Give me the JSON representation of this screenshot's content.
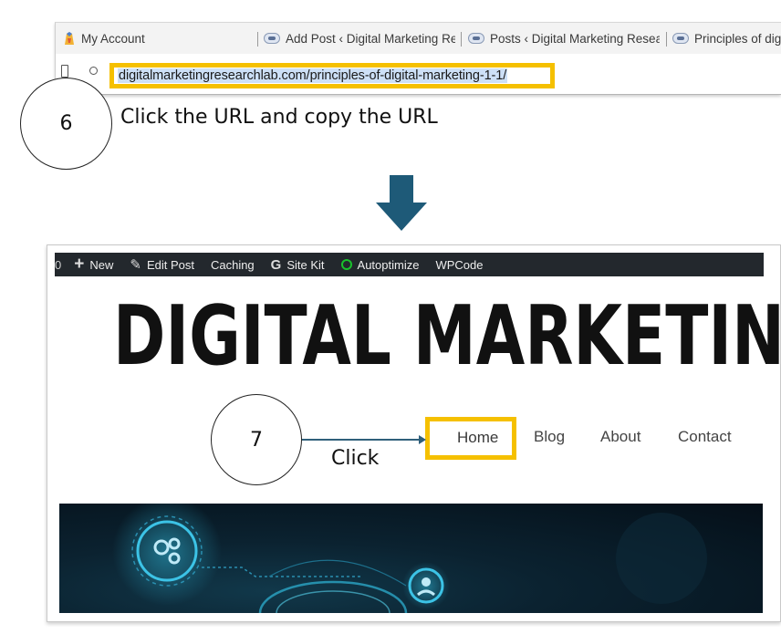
{
  "browser": {
    "tabs": [
      {
        "label": "My Account",
        "favicon": "account-favicon"
      },
      {
        "label": "Add Post ‹ Digital Marketing Res",
        "favicon": "wordpress-favicon"
      },
      {
        "label": "Posts ‹ Digital Marketing Resear",
        "favicon": "wordpress-favicon"
      },
      {
        "label": "Principles of digi",
        "favicon": "wordpress-favicon"
      }
    ],
    "url": "digitalmarketingresearchlab.com/principles-of-digital-marketing-1-1/"
  },
  "steps": [
    {
      "number": "6",
      "instruction": "Click the URL and copy the URL"
    },
    {
      "number": "7",
      "instruction": "Click"
    }
  ],
  "admin_bar": {
    "partial_count": "0",
    "items": [
      {
        "label": "New",
        "icon": "plus-icon"
      },
      {
        "label": "Edit Post",
        "icon": "pencil-icon"
      },
      {
        "label": "Caching",
        "icon": ""
      },
      {
        "label": "Site Kit",
        "icon": "google-g-icon"
      },
      {
        "label": "Autoptimize",
        "icon": "green-ring-icon"
      },
      {
        "label": "WPCode",
        "icon": ""
      }
    ]
  },
  "site": {
    "logo_text": "DIGITAL MARKETING RES",
    "nav": [
      "Home",
      "Blog",
      "About",
      "Contact"
    ]
  },
  "colors": {
    "highlight": "#f5c000",
    "arrow": "#1e5a78",
    "admin_bar_bg": "#23282d",
    "url_selection": "#cde0f7"
  }
}
